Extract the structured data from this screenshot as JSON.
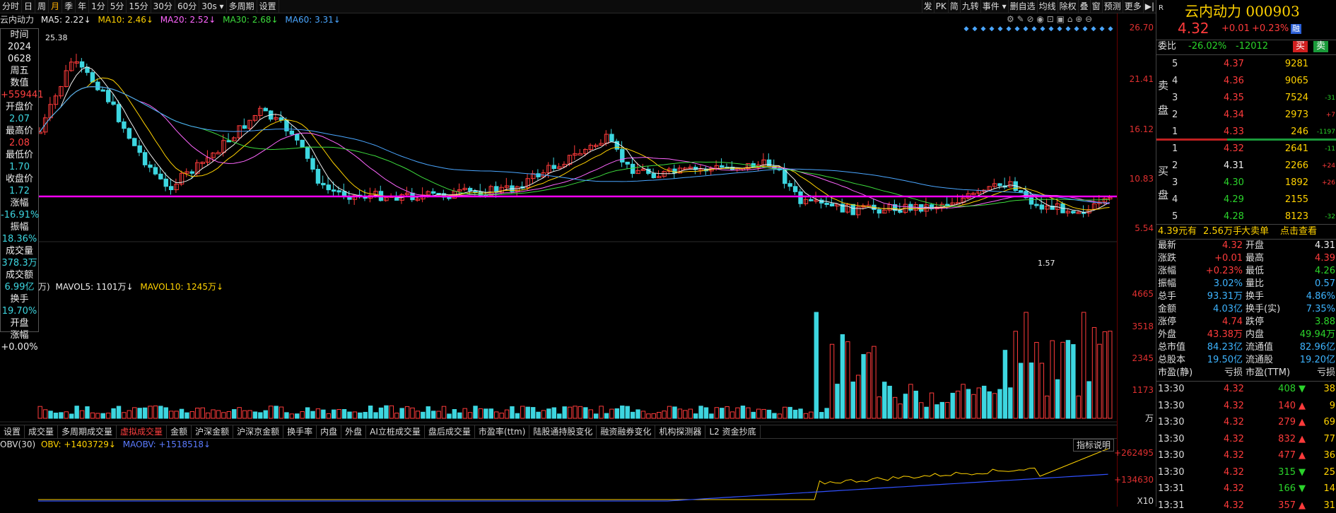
{
  "toolbar": {
    "left": [
      "分时",
      "日",
      "周",
      "月",
      "季",
      "年",
      "1分",
      "5分",
      "15分",
      "30分",
      "60分",
      "30s ▾",
      "多周期",
      "设置"
    ],
    "active_index": 3,
    "right": [
      "发",
      "PK",
      "简",
      "九转",
      "事件 ▾",
      "删自选",
      "均线",
      "除权",
      "叠",
      "窗",
      "预测",
      "更多",
      "▶|"
    ]
  },
  "indicators": {
    "name": "云内动力",
    "ma5": "MA5: 2.22↓",
    "ma10": "MA10: 2.46↓",
    "ma20": "MA20: 2.52↓",
    "ma30": "MA30: 2.68↓",
    "ma60": "MA60: 3.31↓"
  },
  "price_axis": [
    "26.70",
    "21.41",
    "16.12",
    "10.83",
    "5.54"
  ],
  "vol_axis": [
    "4665",
    "3518",
    "2345",
    "1173",
    "万"
  ],
  "obv_axis": [
    "+262495",
    "+134630",
    "X10"
  ],
  "chart_labels": {
    "high_mark": "25.38",
    "low_mark": "1.57"
  },
  "info_panel": [
    {
      "t": "时间",
      "c": "w"
    },
    {
      "t": "2024",
      "c": "w"
    },
    {
      "t": "0628",
      "c": "w"
    },
    {
      "t": "周五",
      "c": "w"
    },
    {
      "t": "数值",
      "c": "w"
    },
    {
      "t": "+559441",
      "c": "r"
    },
    {
      "t": "开盘价",
      "c": "w"
    },
    {
      "t": "2.07",
      "c": "c"
    },
    {
      "t": "最高价",
      "c": "w"
    },
    {
      "t": "2.08",
      "c": "r"
    },
    {
      "t": "最低价",
      "c": "w"
    },
    {
      "t": "1.70",
      "c": "c"
    },
    {
      "t": "收盘价",
      "c": "w"
    },
    {
      "t": "1.72",
      "c": "c"
    },
    {
      "t": "涨幅",
      "c": "w"
    },
    {
      "t": "-16.91%",
      "c": "c"
    },
    {
      "t": "振幅",
      "c": "w"
    },
    {
      "t": "18.36%",
      "c": "c"
    },
    {
      "t": "成交量",
      "c": "w"
    },
    {
      "t": "378.3万",
      "c": "c"
    },
    {
      "t": "成交额",
      "c": "w"
    },
    {
      "t": "6.99亿",
      "c": "c"
    },
    {
      "t": "换手",
      "c": "w"
    },
    {
      "t": "19.70%",
      "c": "c"
    },
    {
      "t": "开盘",
      "c": "w"
    },
    {
      "t": "涨幅",
      "c": "w"
    },
    {
      "t": "+0.00%",
      "c": "w"
    }
  ],
  "volume_line": {
    "vol": "万)",
    "mavol5": "MAVOL5: 1101万↓",
    "mavol10": "MAVOL10: 1245万↓"
  },
  "bottom_tabs": [
    "设置",
    "成交量",
    "多周期成交量",
    "虚拟成交量",
    "金额",
    "沪深金额",
    "沪深京金额",
    "换手率",
    "内盘",
    "外盘",
    "AI立桩成交量",
    "盘后成交量",
    "市盈率(ttm)",
    "陆股通持股变化",
    "融资融券变化",
    "机构探测器",
    "L2 资金抄底"
  ],
  "bottom_active": 3,
  "obv_line": {
    "name": "OBV(30)",
    "obv": "OBV: +1403729↓",
    "maobv": "MAOBV: +1518518↓"
  },
  "index_explain": "指标说明",
  "stock": {
    "name": "云内动力",
    "code": "000903",
    "price": "4.32",
    "change": "+0.01",
    "pct": "+0.23%",
    "tag": "融",
    "corner": "R"
  },
  "weibi": {
    "label": "委比",
    "pct": "-26.02%",
    "diff": "-12012",
    "buy": "买",
    "sell": "卖"
  },
  "sell_label": [
    "卖",
    "盘"
  ],
  "buy_label": [
    "买",
    "盘"
  ],
  "asks": [
    {
      "lvl": "5",
      "price": "4.37",
      "vol": "9281",
      "chg": ""
    },
    {
      "lvl": "4",
      "price": "4.36",
      "vol": "9065",
      "chg": ""
    },
    {
      "lvl": "3",
      "price": "4.35",
      "vol": "7524",
      "chg": "-31"
    },
    {
      "lvl": "2",
      "price": "4.34",
      "vol": "2973",
      "chg": "+7"
    },
    {
      "lvl": "1",
      "price": "4.33",
      "vol": "246",
      "chg": "-1197"
    }
  ],
  "bids": [
    {
      "lvl": "1",
      "price": "4.32",
      "vol": "2641",
      "chg": "-11"
    },
    {
      "lvl": "2",
      "price": "4.31",
      "vol": "2266",
      "chg": "+24"
    },
    {
      "lvl": "3",
      "price": "4.30",
      "vol": "1892",
      "chg": "+26"
    },
    {
      "lvl": "4",
      "price": "4.29",
      "vol": "2155",
      "chg": ""
    },
    {
      "lvl": "5",
      "price": "4.28",
      "vol": "8123",
      "chg": "-32"
    }
  ],
  "big_order": {
    "price": "4.39元有",
    "amount": "2.56万手",
    "label": "大卖单",
    "link": "点击查看"
  },
  "quote": [
    [
      "最新",
      "4.32",
      "开盘",
      "4.31"
    ],
    [
      "涨跌",
      "+0.01",
      "最高",
      "4.39"
    ],
    [
      "涨幅",
      "+0.23%",
      "最低",
      "4.26"
    ],
    [
      "振幅",
      "3.02%",
      "量比",
      "0.57"
    ],
    [
      "总手",
      "93.31万",
      "换手",
      "4.86%"
    ],
    [
      "金额",
      "4.03亿",
      "换手(实)",
      "7.35%"
    ],
    [
      "涨停",
      "4.74",
      "跌停",
      "3.88"
    ],
    [
      "外盘",
      "43.38万",
      "内盘",
      "49.94万"
    ],
    [
      "总市值",
      "84.23亿",
      "流通值",
      "82.96亿"
    ],
    [
      "总股本",
      "19.50亿",
      "流通股",
      "19.20亿"
    ],
    [
      "市盈(静)",
      "亏损",
      "市盈(TTM)",
      "亏损"
    ]
  ],
  "ticks": [
    {
      "time": "13:30",
      "price": "4.32",
      "vol": "408",
      "dir": "down",
      "n": "38"
    },
    {
      "time": "13:30",
      "price": "4.32",
      "vol": "140",
      "dir": "up",
      "n": "9"
    },
    {
      "time": "13:30",
      "price": "4.32",
      "vol": "279",
      "dir": "up",
      "n": "69"
    },
    {
      "time": "13:30",
      "price": "4.32",
      "vol": "832",
      "dir": "up",
      "n": "77"
    },
    {
      "time": "13:30",
      "price": "4.32",
      "vol": "477",
      "dir": "up",
      "n": "36"
    },
    {
      "time": "13:30",
      "price": "4.32",
      "vol": "315",
      "dir": "down",
      "n": "25"
    },
    {
      "time": "13:31",
      "price": "4.32",
      "vol": "166",
      "dir": "down",
      "n": "14"
    },
    {
      "time": "13:31",
      "price": "4.32",
      "vol": "357",
      "dir": "up",
      "n": "31"
    }
  ],
  "colors": {
    "up": "#ff3b3b",
    "down": "#3dd6e0",
    "magenta": "#ff00ff"
  }
}
